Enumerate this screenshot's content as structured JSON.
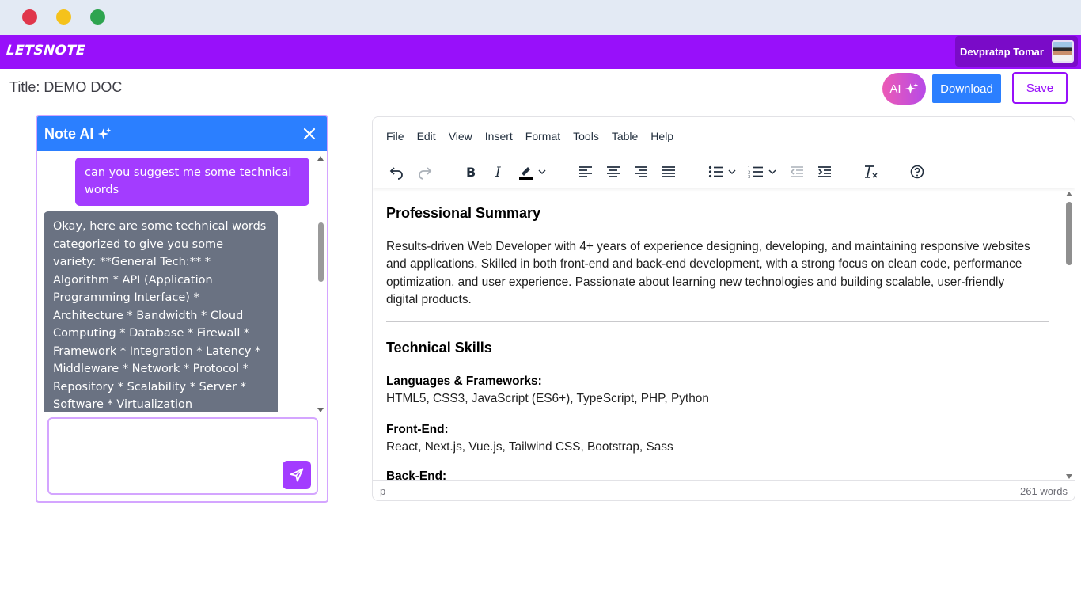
{
  "window": {
    "controls": [
      "close",
      "minimize",
      "maximize"
    ]
  },
  "brand": {
    "logo": "LETSNOTE",
    "color": "#9810fa"
  },
  "user": {
    "name": "Devpratap Tomar"
  },
  "document": {
    "title_label": "Title: DEMO DOC"
  },
  "actions": {
    "ai_label": "AI",
    "download_label": "Download",
    "save_label": "Save"
  },
  "ai_panel": {
    "title": "Note AI",
    "header_color": "#2b7fff",
    "messages": [
      {
        "role": "user",
        "text": "can you suggest me some technical words"
      },
      {
        "role": "assistant",
        "text": "Okay, here are some technical words categorized to give you some variety: **General Tech:** * Algorithm * API (Application Programming Interface) * Architecture * Bandwidth * Cloud Computing * Database * Firewall * Framework * Integration * Latency * Middleware * Network * Protocol * Repository * Scalability * Server * Software * Virtualization"
      }
    ],
    "input_value": ""
  },
  "editor": {
    "menu": [
      "File",
      "Edit",
      "View",
      "Insert",
      "Format",
      "Tools",
      "Table",
      "Help"
    ],
    "toolbar_icons": [
      "undo-icon",
      "redo-icon",
      "bold-icon",
      "italic-icon",
      "highlight-icon",
      "align-left-icon",
      "align-center-icon",
      "align-right-icon",
      "justify-icon",
      "bullet-list-icon",
      "numbered-list-icon",
      "outdent-icon",
      "indent-icon",
      "clear-format-icon",
      "help-icon"
    ],
    "content": {
      "h1": "Professional Summary",
      "summary": "Results-driven Web Developer with 4+ years of experience designing, developing, and maintaining responsive websites and applications. Skilled in both front-end and back-end development, with a strong focus on clean code, performance optimization, and user experience. Passionate about learning new technologies and building scalable, user-friendly digital products.",
      "h2": "Technical Skills",
      "skills": [
        {
          "label": "Languages & Frameworks:",
          "value": "HTML5, CSS3, JavaScript (ES6+), TypeScript, PHP, Python"
        },
        {
          "label": "Front-End:",
          "value": "React, Next.js, Vue.js, Tailwind CSS, Bootstrap, Sass"
        },
        {
          "label": "Back-End:",
          "value": ""
        }
      ]
    },
    "status": {
      "path": "p",
      "word_count": "261 words"
    }
  }
}
